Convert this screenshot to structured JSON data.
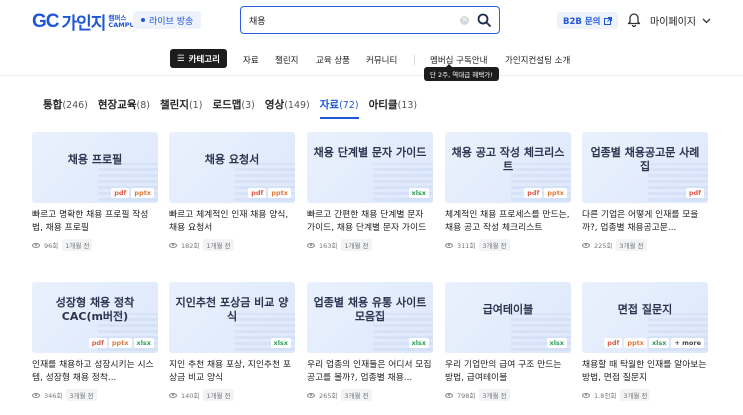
{
  "header": {
    "logo_mark": "GC",
    "logo_text": "가인지",
    "logo_sub_1": "캠퍼스",
    "logo_sub_2": "CAMPUS",
    "live_label": "라이브 방송",
    "search_value": "채용",
    "b2b_label": "B2B 문의",
    "mypage_label": "마이페이지",
    "accent": "#1f56d8"
  },
  "nav": {
    "category_label": "카테고리",
    "items": [
      "자료",
      "챌린지",
      "교육 상품",
      "커뮤니티",
      "멤버십 구독안내",
      "가인지컨설팅 소개"
    ],
    "tooltip": "단 2주, 역대급 혜택가!"
  },
  "tabs": [
    {
      "label": "통합",
      "count": "(246)"
    },
    {
      "label": "현장교육",
      "count": "(8)"
    },
    {
      "label": "챌린지",
      "count": "(1)"
    },
    {
      "label": "로드맵",
      "count": "(3)"
    },
    {
      "label": "영상",
      "count": "(149)"
    },
    {
      "label": "자료",
      "count": "(72)"
    },
    {
      "label": "아티클",
      "count": "(13)"
    }
  ],
  "cards": [
    {
      "thumb": "채용 프로필",
      "tags": [
        "pdf",
        "pptx"
      ],
      "title": "빠르고 명확한 채용 프로필 작성법, 채용 프로필",
      "views": "96회",
      "ago": "1개월 전"
    },
    {
      "thumb": "채용 요청서",
      "tags": [
        "pdf",
        "pptx"
      ],
      "title": "빠르고 체계적인 인재 채용 양식, 채용 요청서",
      "views": "182회",
      "ago": "1개월 전"
    },
    {
      "thumb": "채용 단계별 문자 가이드",
      "tags": [
        "xlsx"
      ],
      "title": "빠르고 간편한 채용 단계별 문자 가이드, 채용 단계별 문자 가이드",
      "views": "163회",
      "ago": "1개월 전"
    },
    {
      "thumb": "채용 공고 작성 체크리스트",
      "tags": [
        "pdf",
        "pptx"
      ],
      "title": "체계적인 채용 프로세스를 만드는, 채용 공고 작성 체크리스트",
      "views": "311회",
      "ago": "3개월 전"
    },
    {
      "thumb": "업종별 채용공고문 사례집",
      "tags": [
        "pdf"
      ],
      "title": "다른 기업은 어떻게 인재를 모을까?, 업종별 채용공고문...",
      "views": "225회",
      "ago": "3개월 전"
    },
    {
      "thumb": "성장형 채용 정착 CAC(m버전)",
      "tags": [
        "pdf",
        "pptx",
        "xlsx"
      ],
      "title": "인재를 채용하고 성장시키는 시스템, 성장형 채용 정착...",
      "views": "346회",
      "ago": "3개월 전"
    },
    {
      "thumb": "지인추천 포상금 비교 양식",
      "tags": [
        "xlsx"
      ],
      "title": "지인 추천 채용 포상, 지인추천 포상금 비교 양식",
      "views": "140회",
      "ago": "1개월 전"
    },
    {
      "thumb": "업종별 채용 유통 사이트 모음집",
      "tags": [
        "xlsx"
      ],
      "title": "우리 업종의 인재들은 어디서 모집공고를 볼까?, 업종별 채용...",
      "views": "265회",
      "ago": "3개월 전"
    },
    {
      "thumb": "급여테이블",
      "tags": [
        "xlsx"
      ],
      "title": "우리 기업만의 급여 구조 만드는 방법, 급여테이블",
      "views": "798회",
      "ago": "3개월 전"
    },
    {
      "thumb": "면접 질문지",
      "tags": [
        "pdf",
        "pptx",
        "xlsx",
        "+ more"
      ],
      "title": "채용할 때 탁월한 인재를 알아보는 방법, 면접 질문지",
      "views": "1.8천회",
      "ago": "3개월 전"
    }
  ]
}
